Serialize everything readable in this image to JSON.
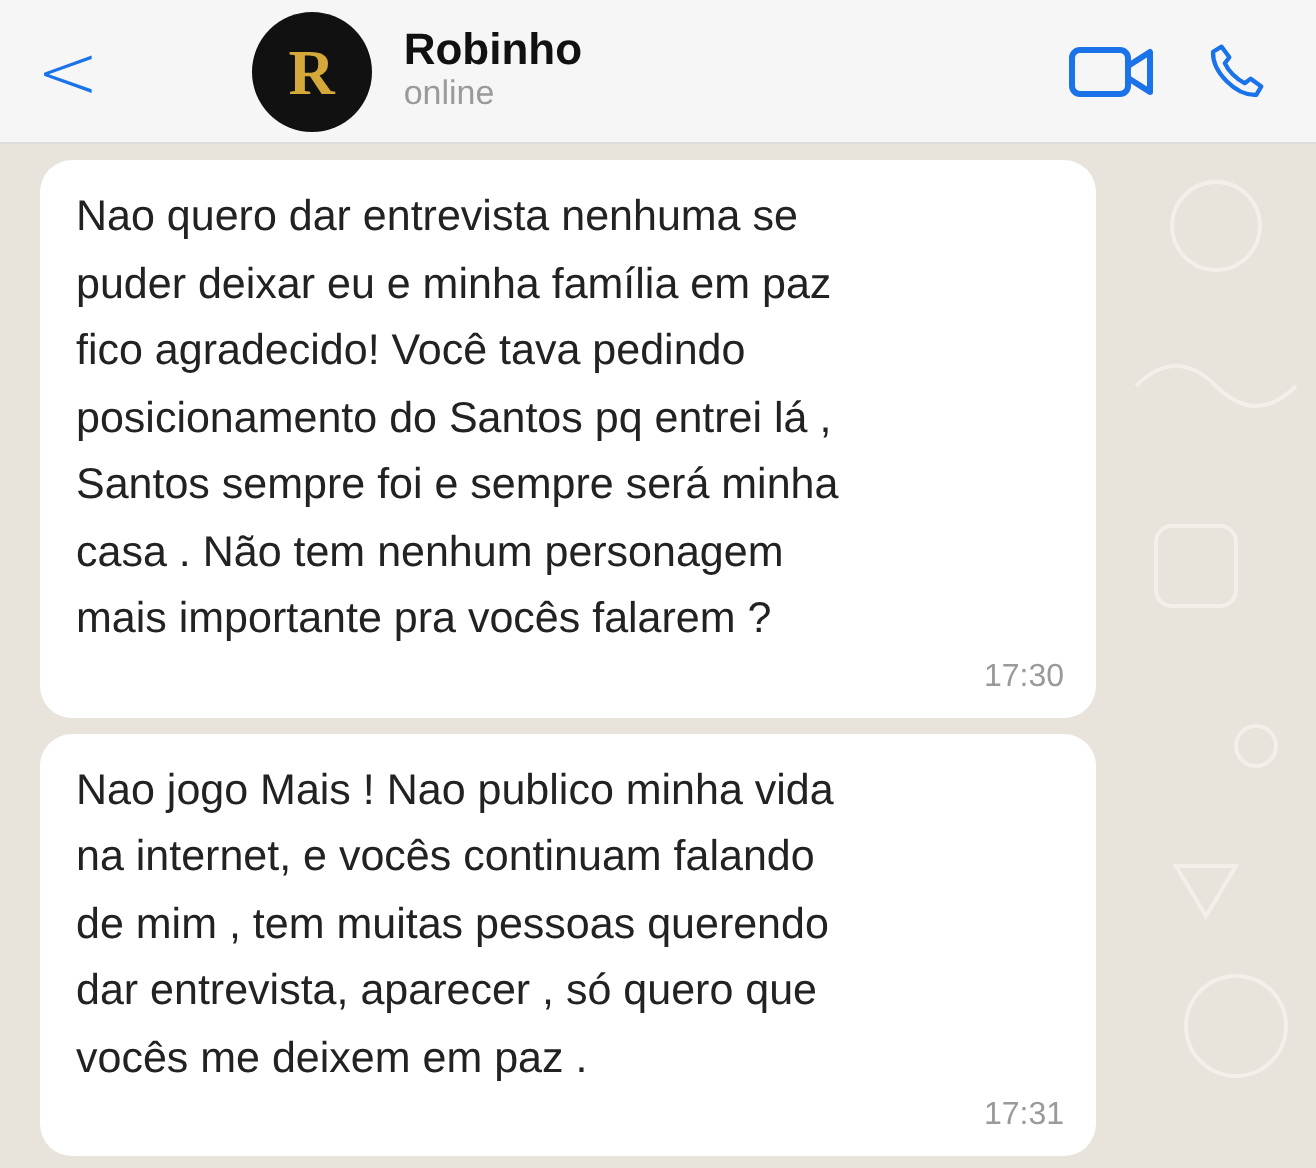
{
  "header": {
    "back": "<",
    "avatar_letter": "R",
    "name": "Robinho",
    "status": "online"
  },
  "messages": [
    {
      "text": "Nao quero dar entrevista nenhuma se\npuder deixar eu e minha família em paz\nfico agradecido! Você tava pedindo\nposicionamento do Santos pq entrei lá ,\nSantos sempre foi e sempre será minha\ncasa . Não tem nenhum personagem\nmais importante pra vocês falarem ?",
      "time": "17:30"
    },
    {
      "text": "Nao jogo Mais ! Nao publico minha vida\nna internet, e vocês continuam falando\nde mim , tem muitas pessoas querendo\ndar entrevista, aparecer , só quero que\nvocês me deixem em paz .",
      "time": "17:31"
    }
  ]
}
